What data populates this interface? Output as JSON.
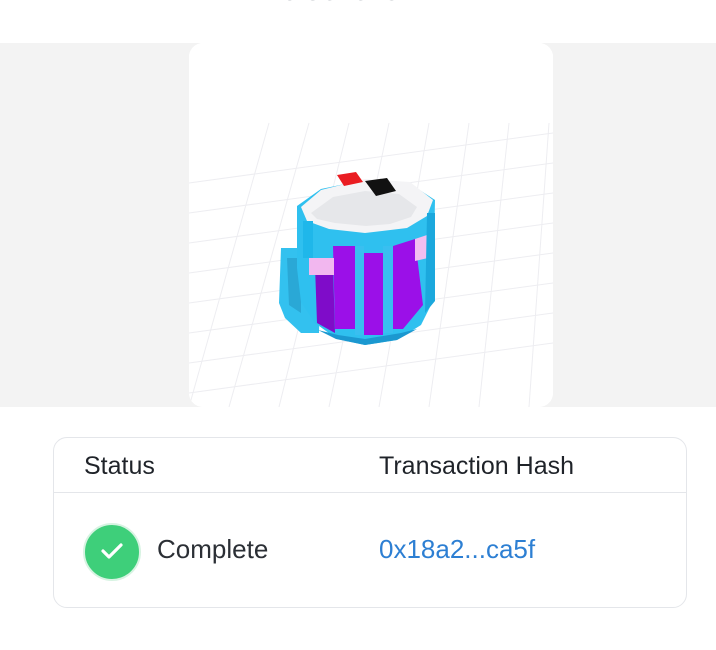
{
  "header": {
    "partial_text": "blockchain."
  },
  "preview": {
    "image_name": "voxel-mug"
  },
  "transaction": {
    "columns": {
      "status": "Status",
      "hash": "Transaction Hash"
    },
    "status_value": "Complete",
    "hash_value": "0x18a2...ca5f",
    "colors": {
      "success": "#3ecf7a",
      "link": "#2d7fd3"
    }
  }
}
